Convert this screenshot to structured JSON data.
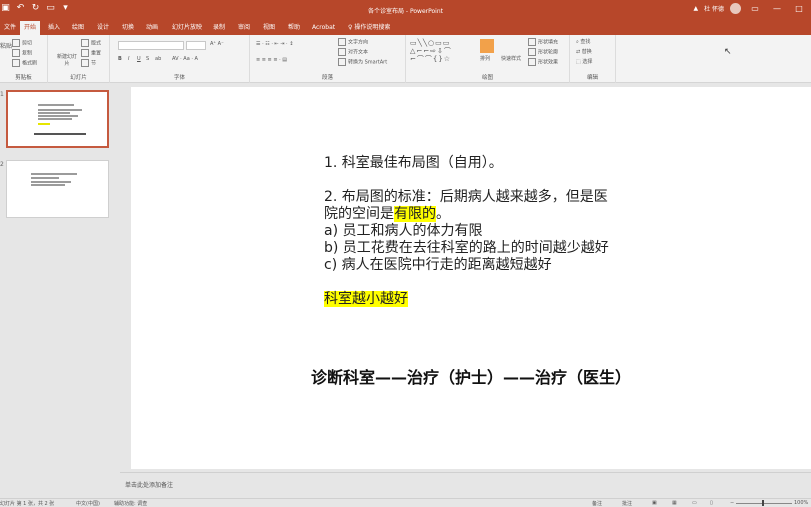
{
  "titlebar": {
    "doc_title": "各个诊室布局 - PowerPoint",
    "warning": "▲",
    "user": "杜 怀德"
  },
  "tabs": [
    "文件",
    "开始",
    "插入",
    "绘图",
    "设计",
    "切换",
    "动画",
    "幻灯片放映",
    "录制",
    "审阅",
    "视图",
    "帮助",
    "Acrobat"
  ],
  "tell_me": "操作说明搜索",
  "ribbon": {
    "clipboard": {
      "paste": "粘贴",
      "cut": "剪切",
      "copy": "复制",
      "format_painter": "格式刷",
      "label": "剪贴板"
    },
    "slides": {
      "new_slide": "新建幻灯片",
      "layout": "版式",
      "reset": "重置",
      "section": "节",
      "label": "幻灯片"
    },
    "font": {
      "label": "字体",
      "bold": "B",
      "italic": "I",
      "underline": "U",
      "strike": "S",
      "shadow": "ab"
    },
    "paragraph": {
      "label": "段落",
      "text_direction": "文字方向",
      "align_text": "对齐文本",
      "smartart": "转换为 SmartArt"
    },
    "drawing": {
      "label": "绘图",
      "arrange": "排列",
      "quick_styles": "快速样式",
      "shape_fill": "形状填充",
      "shape_outline": "形状轮廓",
      "shape_effects": "形状效果"
    },
    "editing": {
      "label": "编辑",
      "find": "查找",
      "replace": "替换",
      "select": "选择"
    }
  },
  "thumbnails": [
    {
      "number": "1"
    },
    {
      "number": "2"
    }
  ],
  "slide": {
    "line1": "1. 科室最佳布局图（自用）。",
    "line2": "2. 布局图的标准：后期病人越来越多，但是医",
    "line3_pre": "院的空间是",
    "line3_hl": "有限的",
    "line3_post": "。",
    "item_a": "a)  员工和病人的体力有限",
    "item_b": "b)  员工花费在去往科室的路上的时间越少越好",
    "item_c": "c)  病人在医院中行走的距离越短越好",
    "highlight_line": "科室越小越好",
    "flow_line": "诊断科室——治疗（护士）——治疗（医生）"
  },
  "notes_placeholder": "单击此处添加备注",
  "status": {
    "slide_count": "幻灯片 第 1 张，共 2 张",
    "language": "中文(中国)",
    "accessibility": "辅助功能: 调查",
    "notes": "备注",
    "comments": "批注",
    "zoom": "100%"
  },
  "colors": {
    "accent": "#b7472a",
    "highlight": "#ffff00"
  }
}
